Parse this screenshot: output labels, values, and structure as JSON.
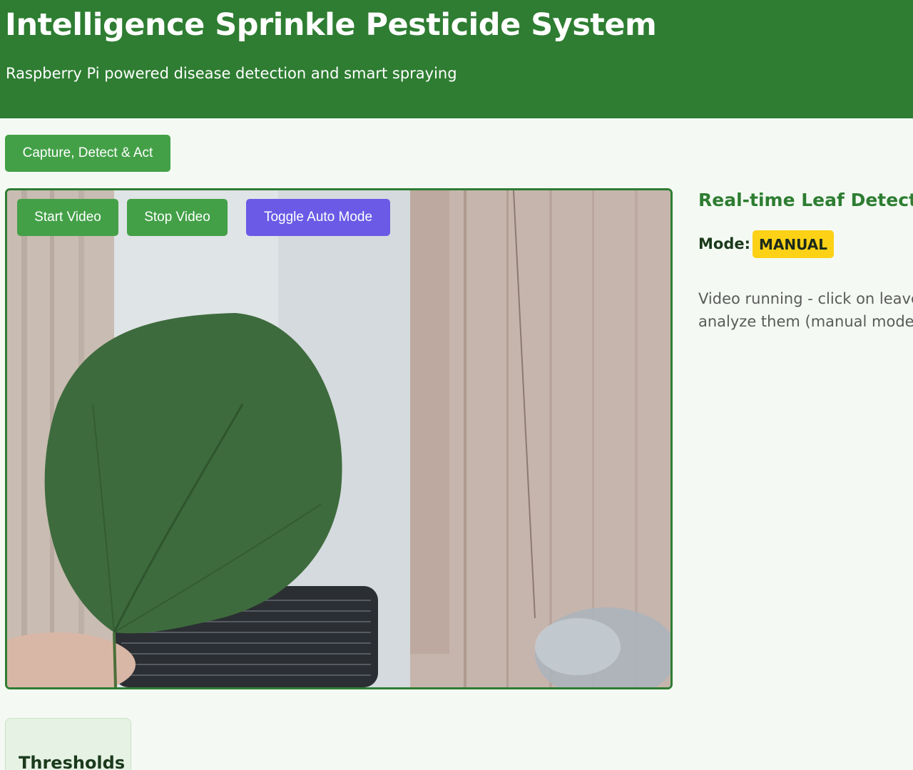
{
  "header": {
    "title": "Intelligence Sprinkle Pesticide System",
    "subtitle": "Raspberry Pi powered disease detection and smart spraying"
  },
  "actions": {
    "capture_label": "Capture, Detect & Act"
  },
  "video": {
    "start_label": "Start Video",
    "stop_label": "Stop Video",
    "toggle_label": "Toggle Auto Mode"
  },
  "side": {
    "title": "Real-time Leaf Detection",
    "mode_label": "Mode:",
    "mode_value": "MANUAL",
    "status": "Video running - click on leaves to analyze them (manual mode)"
  },
  "thresholds": {
    "title": "Thresholds"
  },
  "colors": {
    "primary": "#2e7d32",
    "button_green": "#43a047",
    "button_purple": "#6a5ae6",
    "badge_yellow": "#fcd116",
    "page_bg": "#f4faf3"
  }
}
